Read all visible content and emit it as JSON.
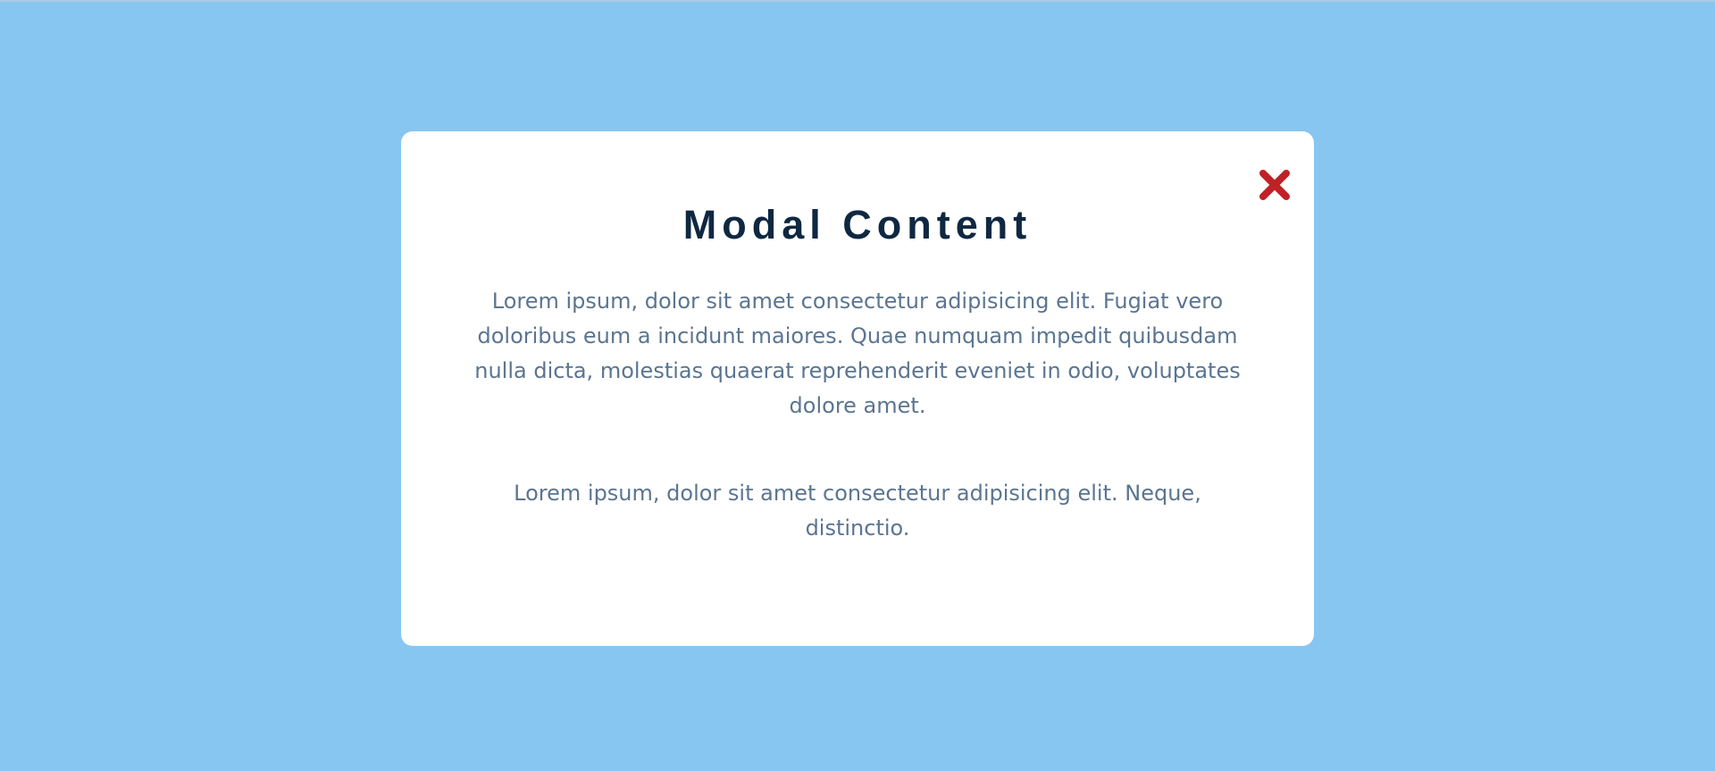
{
  "page": {
    "background_color": "#88c6f2"
  },
  "modal": {
    "title": "Modal Content",
    "paragraphs": [
      "Lorem ipsum, dolor sit amet consectetur adipisicing elit. Fugiat vero doloribus eum a incidunt maiores. Quae numquam impedit quibusdam nulla dicta, molestias quaerat reprehenderit eveniet in odio, voluptates dolore amet.",
      "Lorem ipsum, dolor sit amet consectetur adipisicing elit. Neque, distinctio."
    ],
    "close_icon": "close-icon",
    "close_color": "#c02126",
    "title_color": "#0f2841",
    "text_color": "#5b7590"
  }
}
